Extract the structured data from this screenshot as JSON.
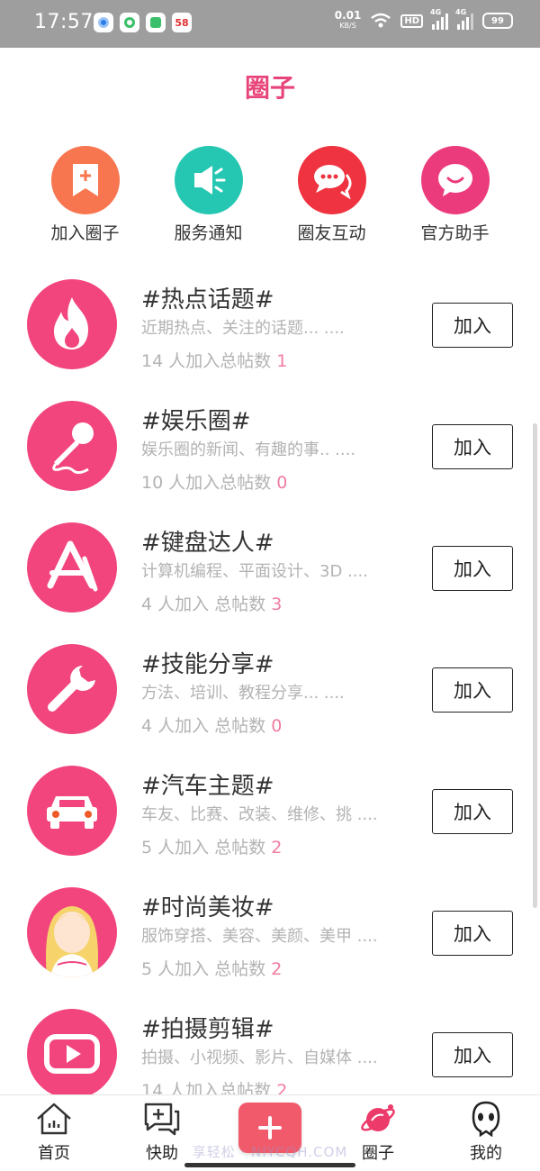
{
  "status_bar": {
    "time": "17:57",
    "app_58_label": "58",
    "net_speed": "0.01",
    "net_unit": "KB/S",
    "hd": "HD",
    "sig1": "4G",
    "sig2": "4G",
    "battery": "99"
  },
  "header": {
    "title": "圈子"
  },
  "quick_actions": [
    {
      "label": "加入圈子",
      "icon": "bookmark-plus-icon",
      "color": "#f7764f"
    },
    {
      "label": "服务通知",
      "icon": "megaphone-icon",
      "color": "#25c7b2"
    },
    {
      "label": "圈友互动",
      "icon": "chat-bubbles-icon",
      "color": "#ef3340"
    },
    {
      "label": "官方助手",
      "icon": "smile-bubble-icon",
      "color": "#ec3b7c"
    }
  ],
  "circles": [
    {
      "name": "#热点话题#",
      "desc": "近期热点、关注的话题... ....",
      "members": "14 人加入",
      "posts_label": "总帖数",
      "posts": "1",
      "icon": "fire-icon",
      "join_label": "加入"
    },
    {
      "name": "#娱乐圈#",
      "desc": "娱乐圈的新闻、有趣的事.. ....",
      "members": "10 人加入",
      "posts_label": "总帖数",
      "posts": "0",
      "icon": "microphone-icon",
      "join_label": "加入"
    },
    {
      "name": "#键盘达人#",
      "desc": "计算机编程、平面设计、3D ....",
      "members": "4 人加入",
      "posts_label": "总帖数",
      "posts": "3",
      "icon": "app-store-icon",
      "join_label": "加入"
    },
    {
      "name": "#技能分享#",
      "desc": "方法、培训、教程分享... ....",
      "members": "4 人加入",
      "posts_label": "总帖数",
      "posts": "0",
      "icon": "wrench-icon",
      "join_label": "加入"
    },
    {
      "name": "#汽车主题#",
      "desc": "车友、比赛、改装、维修、挑 ....",
      "members": "5 人加入",
      "posts_label": "总帖数",
      "posts": "2",
      "icon": "car-icon",
      "join_label": "加入"
    },
    {
      "name": "#时尚美妆#",
      "desc": "服饰穿搭、美容、美颜、美甲 ....",
      "members": "5 人加入",
      "posts_label": "总帖数",
      "posts": "2",
      "icon": "girl-avatar-icon",
      "join_label": "加入"
    },
    {
      "name": "#拍摄剪辑#",
      "desc": "拍摄、小视频、影片、自媒体 ....",
      "members": "14 人加入",
      "posts_label": "总帖数",
      "posts": "2",
      "icon": "video-play-icon",
      "join_label": "加入"
    }
  ],
  "bottom_nav": {
    "home": "首页",
    "helper": "快助",
    "circles": "圈子",
    "mine": "我的",
    "add_icon": "plus-icon"
  },
  "watermark": "享轻松 · NIYCQH.COM",
  "colors": {
    "accent": "#e8467a",
    "avatar_bg": "#f2457d",
    "stat_pink": "#f07ca0",
    "add_button": "#f05a6a"
  }
}
